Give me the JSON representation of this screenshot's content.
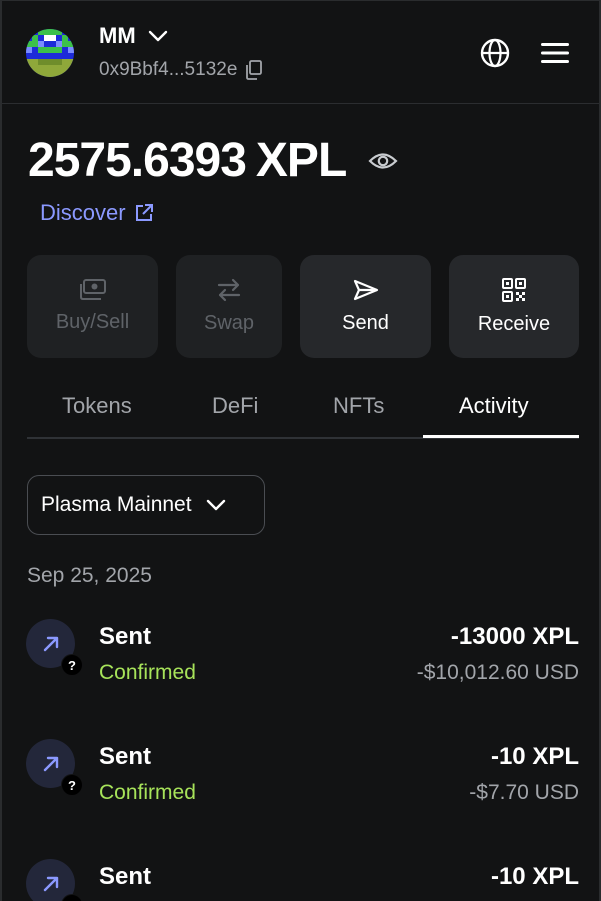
{
  "account": {
    "name": "MM",
    "address": "0x9Bbf4...5132e"
  },
  "balance": {
    "amount": "2575.6393",
    "unit": "XPL"
  },
  "discover_label": "Discover",
  "actions": [
    {
      "label": "Buy/Sell",
      "icon": "cash-icon",
      "enabled": false
    },
    {
      "label": "Swap",
      "icon": "swap-arrows-icon",
      "enabled": false
    },
    {
      "label": "Send",
      "icon": "send-icon",
      "enabled": true
    },
    {
      "label": "Receive",
      "icon": "qr-code-icon",
      "enabled": true
    }
  ],
  "tabs": [
    {
      "label": "Tokens",
      "active": false
    },
    {
      "label": "DeFi",
      "active": false
    },
    {
      "label": "NFTs",
      "active": false
    },
    {
      "label": "Activity",
      "active": true
    }
  ],
  "network": {
    "selected": "Plasma Mainnet"
  },
  "activity": {
    "date": "Sep 25, 2025",
    "items": [
      {
        "title": "Sent",
        "status": "Confirmed",
        "amount": "-13000 XPL",
        "fiat": "-$10,012.60 USD"
      },
      {
        "title": "Sent",
        "status": "Confirmed",
        "amount": "-10 XPL",
        "fiat": "-$7.70 USD"
      },
      {
        "title": "Sent",
        "status": "",
        "amount": "-10 XPL",
        "fiat": ""
      }
    ]
  },
  "colors": {
    "background": "#121314",
    "accent_link": "#8b99ff",
    "status_confirmed": "#a7e35a",
    "muted_text": "#a2a5aa"
  }
}
